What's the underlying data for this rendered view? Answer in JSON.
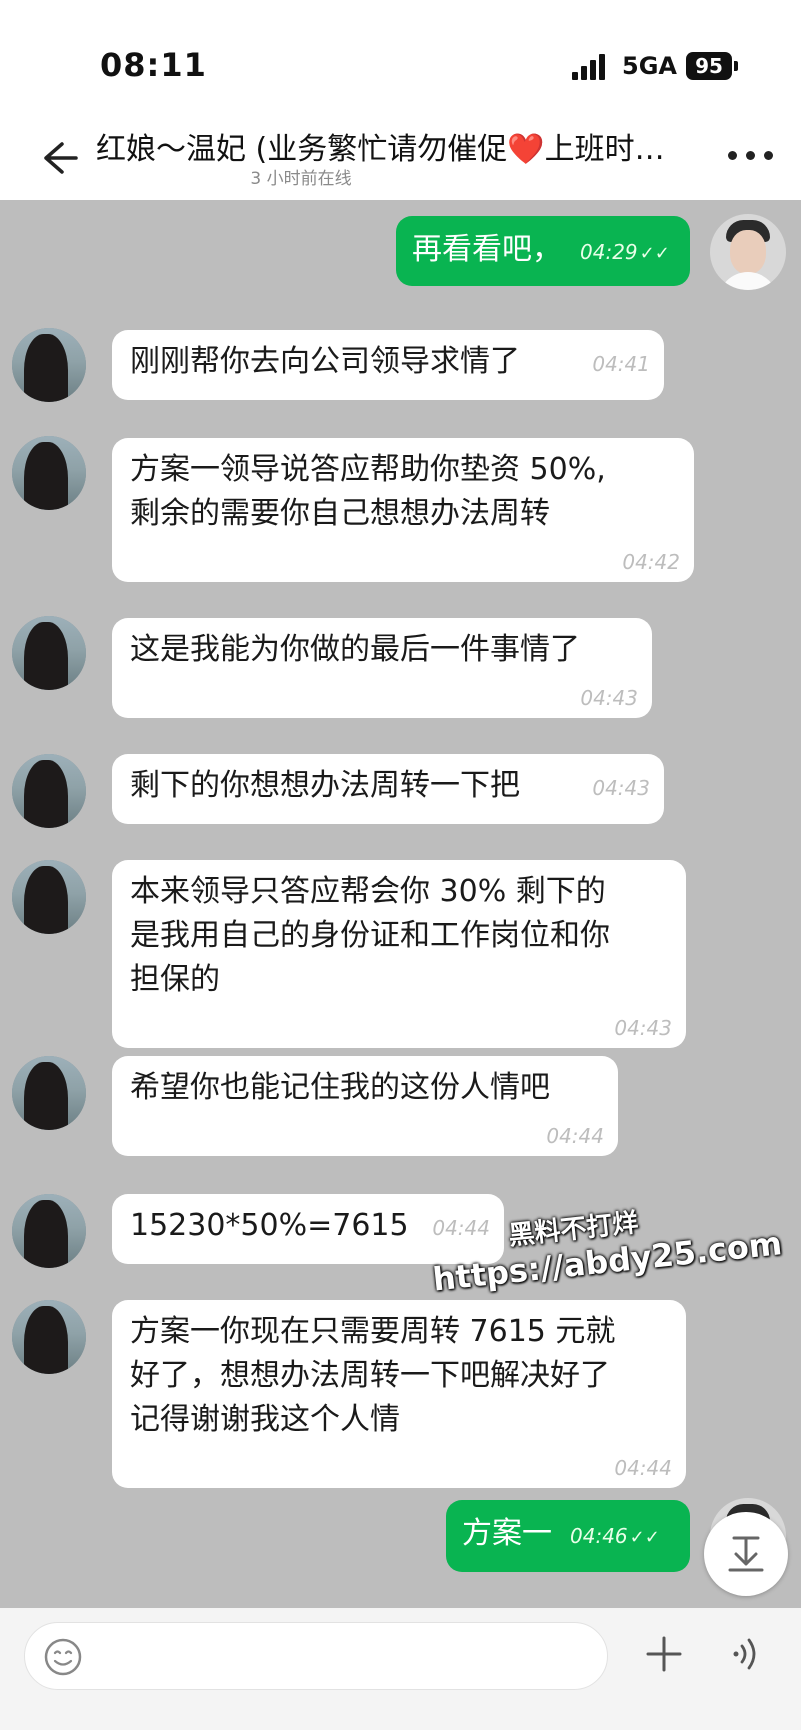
{
  "status": {
    "time": "08:11",
    "network": "5GA",
    "battery": "95"
  },
  "header": {
    "title": "红娘～温妃 (业务繁忙请勿催促❤️上班时…",
    "subtitle": "3 小时前在线"
  },
  "messages": [
    {
      "dir": "out",
      "text": "再看看吧，",
      "time": "04:29",
      "ticks": "✓✓"
    },
    {
      "dir": "in",
      "lines": [
        "刚刚帮你去向公司领导求情了"
      ],
      "time": "04:41"
    },
    {
      "dir": "in",
      "lines": [
        "方案一领导说答应帮助你垫资 50%,",
        "剩余的需要你自己想想办法周转"
      ],
      "time": "04:42"
    },
    {
      "dir": "in",
      "lines": [
        "这是我能为你做的最后一件事情了"
      ],
      "time": "04:43"
    },
    {
      "dir": "in",
      "lines": [
        "剩下的你想想办法周转一下把"
      ],
      "time": "04:43"
    },
    {
      "dir": "in",
      "lines": [
        "本来领导只答应帮会你 30% 剩下的",
        "是我用自己的身份证和工作岗位和你",
        "担保的"
      ],
      "time": "04:43"
    },
    {
      "dir": "in",
      "lines": [
        "希望你也能记住我的这份人情吧"
      ],
      "time": "04:44"
    },
    {
      "dir": "in",
      "lines": [
        "15230*50%=7615"
      ],
      "time": "04:44"
    },
    {
      "dir": "in",
      "lines": [
        "方案一你现在只需要周转 7615 元就",
        "好了，想想办法周转一下吧解决好了",
        "记得谢谢我这个人情"
      ],
      "time": "04:44"
    },
    {
      "dir": "out",
      "text": "方案一",
      "time": "04:46",
      "ticks": "✓✓"
    }
  ],
  "watermark": {
    "line1": "黑料不打烊",
    "line2": "https://abdy25.com"
  },
  "input": {
    "placeholder": ""
  },
  "colors": {
    "outgoing_bubble": "#09b451",
    "incoming_bubble": "#ffffff",
    "chat_background": "#bdbdbd"
  },
  "icons": {
    "back": "back-arrow-icon",
    "more": "more-dots-icon",
    "emoji": "emoji-icon",
    "plus": "plus-icon",
    "voice": "voice-icon",
    "scroll": "scroll-down-icon"
  }
}
